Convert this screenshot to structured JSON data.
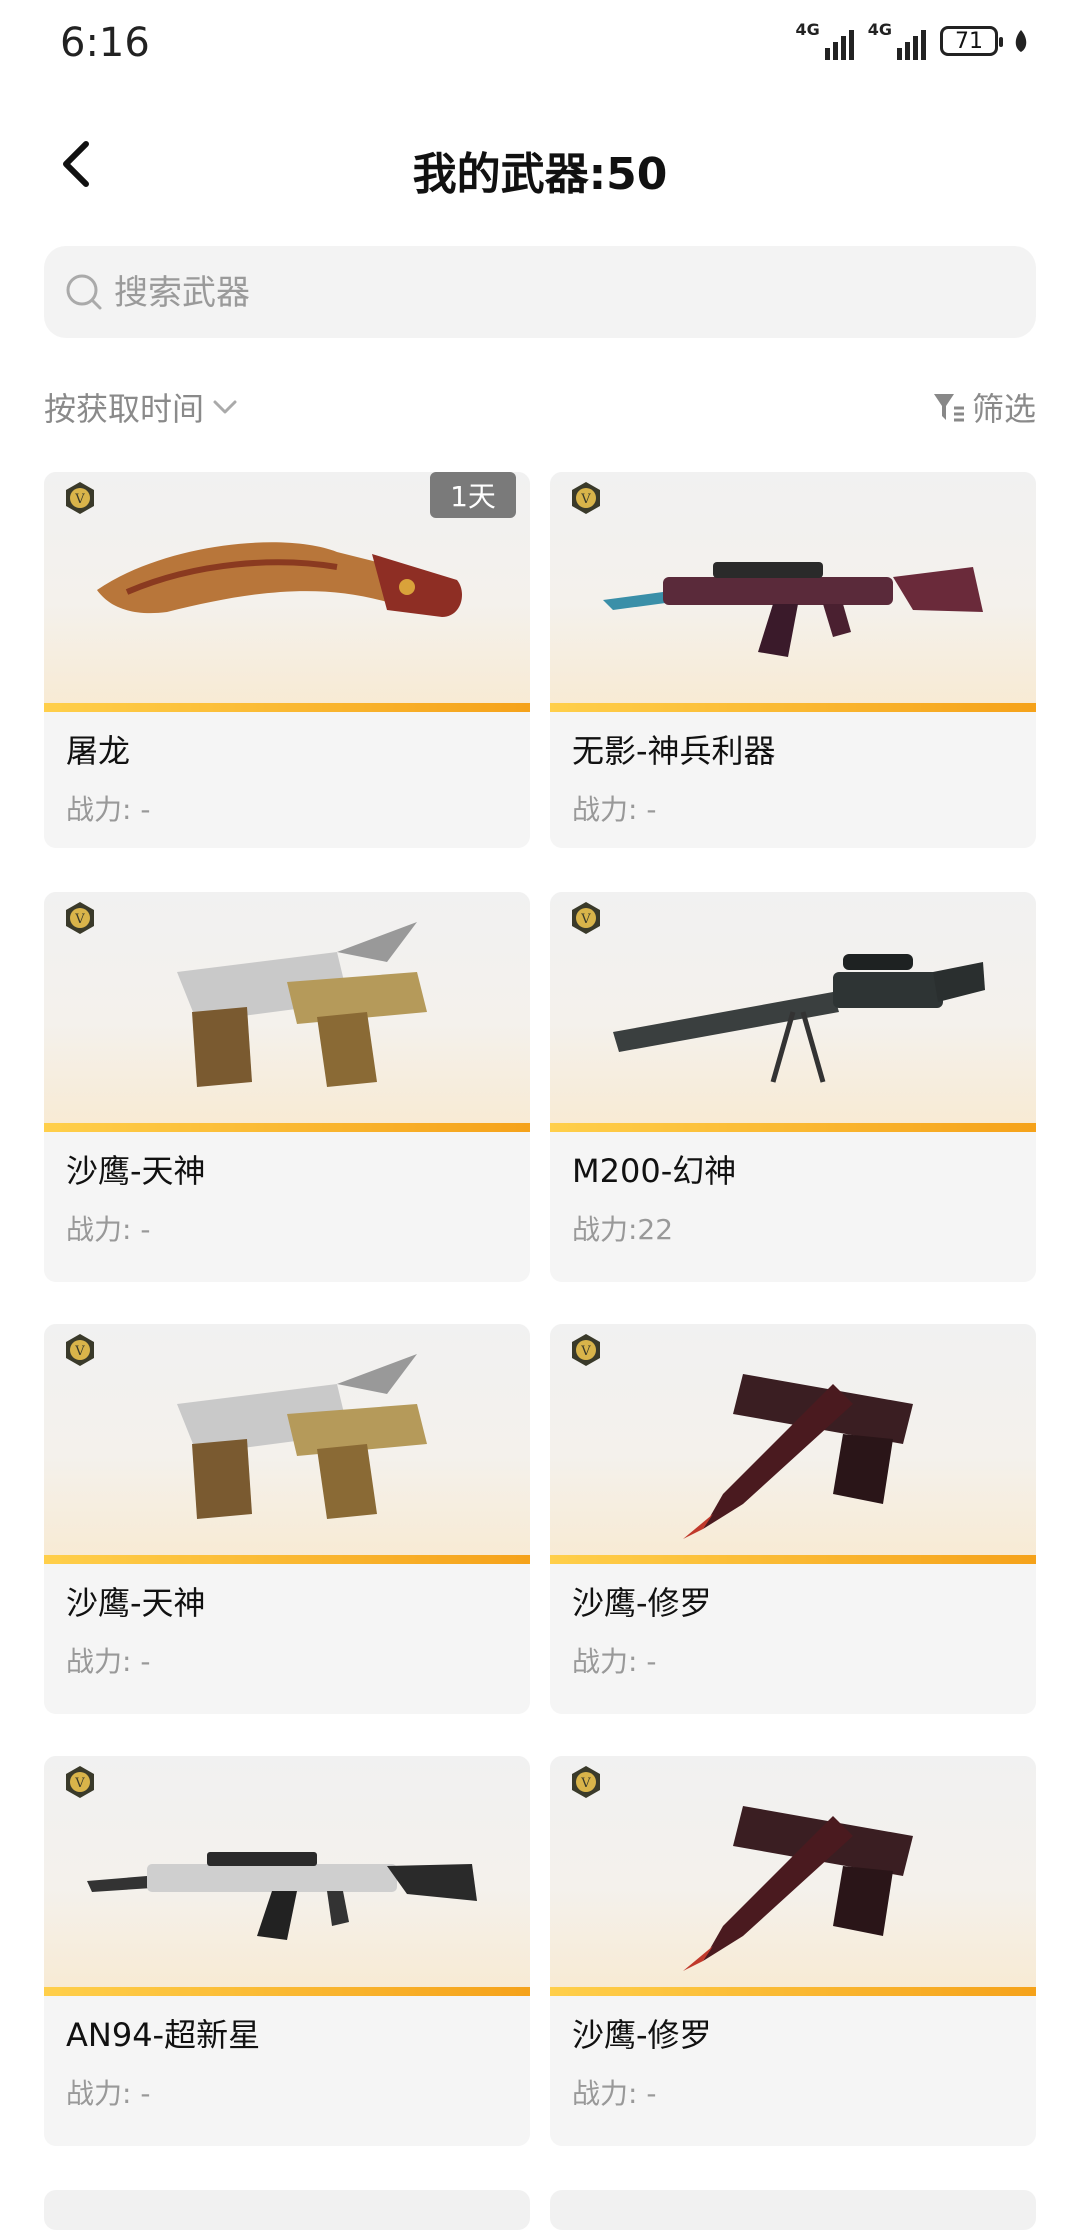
{
  "status_bar": {
    "time": "6:16",
    "network1": "4G",
    "network2": "4G",
    "battery": "71"
  },
  "header": {
    "title": "我的武器:50"
  },
  "search": {
    "placeholder": "搜索武器"
  },
  "toolbar": {
    "sort_label": "按获取时间",
    "filter_label": "筛选"
  },
  "colors": {
    "accent_stripe": "#f5a21a",
    "card_bg": "#f5f5f5",
    "muted_text": "#999999"
  },
  "weapons": [
    {
      "name": "屠龙",
      "power": "战力: -",
      "tag": "1天",
      "art": "knife"
    },
    {
      "name": "无影-神兵利器",
      "power": "战力: -",
      "art": "rifle"
    },
    {
      "name": "沙鹰-天神",
      "power": "战力: -",
      "art": "pistols-gold"
    },
    {
      "name": "M200-幻神",
      "power": "战力:22",
      "art": "sniper"
    },
    {
      "name": "沙鹰-天神",
      "power": "战力: -",
      "art": "pistols-gold"
    },
    {
      "name": "沙鹰-修罗",
      "power": "战力: -",
      "art": "pistols-dark"
    },
    {
      "name": "AN94-超新星",
      "power": "战力: -",
      "art": "rifle-silver"
    },
    {
      "name": "沙鹰-修罗",
      "power": "战力: -",
      "art": "pistols-dark"
    }
  ]
}
